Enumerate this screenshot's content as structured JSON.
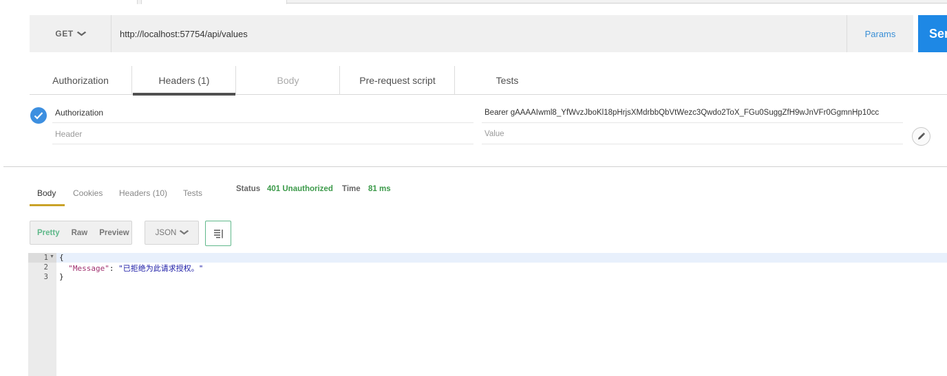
{
  "request": {
    "method": "GET",
    "url": "http://localhost:57754/api/values",
    "params_label": "Params",
    "send_label": "Send"
  },
  "request_tabs": [
    {
      "label": "Authorization"
    },
    {
      "label": "Headers (1)"
    },
    {
      "label": "Body"
    },
    {
      "label": "Pre-request script"
    },
    {
      "label": "Tests"
    }
  ],
  "headers": {
    "row": {
      "key": "Authorization",
      "value": "Bearer gAAAAIwml8_YfWvzJboKl18pHrjsXMdrbbQbVtWezc3Qwdo2ToX_FGu0SuggZfH9wJnVFr0GgmnHp10cc"
    },
    "key_placeholder": "Header",
    "value_placeholder": "Value"
  },
  "response_tabs": [
    {
      "label": "Body"
    },
    {
      "label": "Cookies"
    },
    {
      "label": "Headers (10)"
    },
    {
      "label": "Tests"
    }
  ],
  "response_status": {
    "status_label": "Status",
    "status_value": "401 Unauthorized",
    "time_label": "Time",
    "time_value": "81 ms"
  },
  "view": {
    "modes": [
      "Pretty",
      "Raw",
      "Preview"
    ],
    "format": "JSON"
  },
  "body_lines": {
    "n1": "1",
    "n2": "2",
    "n3": "3",
    "open": "{",
    "key": "\"Message\"",
    "colon": ": ",
    "value": "\"已拒绝为此请求授权。\"",
    "close": "}"
  },
  "colors": {
    "accent_blue": "#1e88e5",
    "status_green": "#3c9a4a",
    "tab_underline": "#c9a227"
  }
}
